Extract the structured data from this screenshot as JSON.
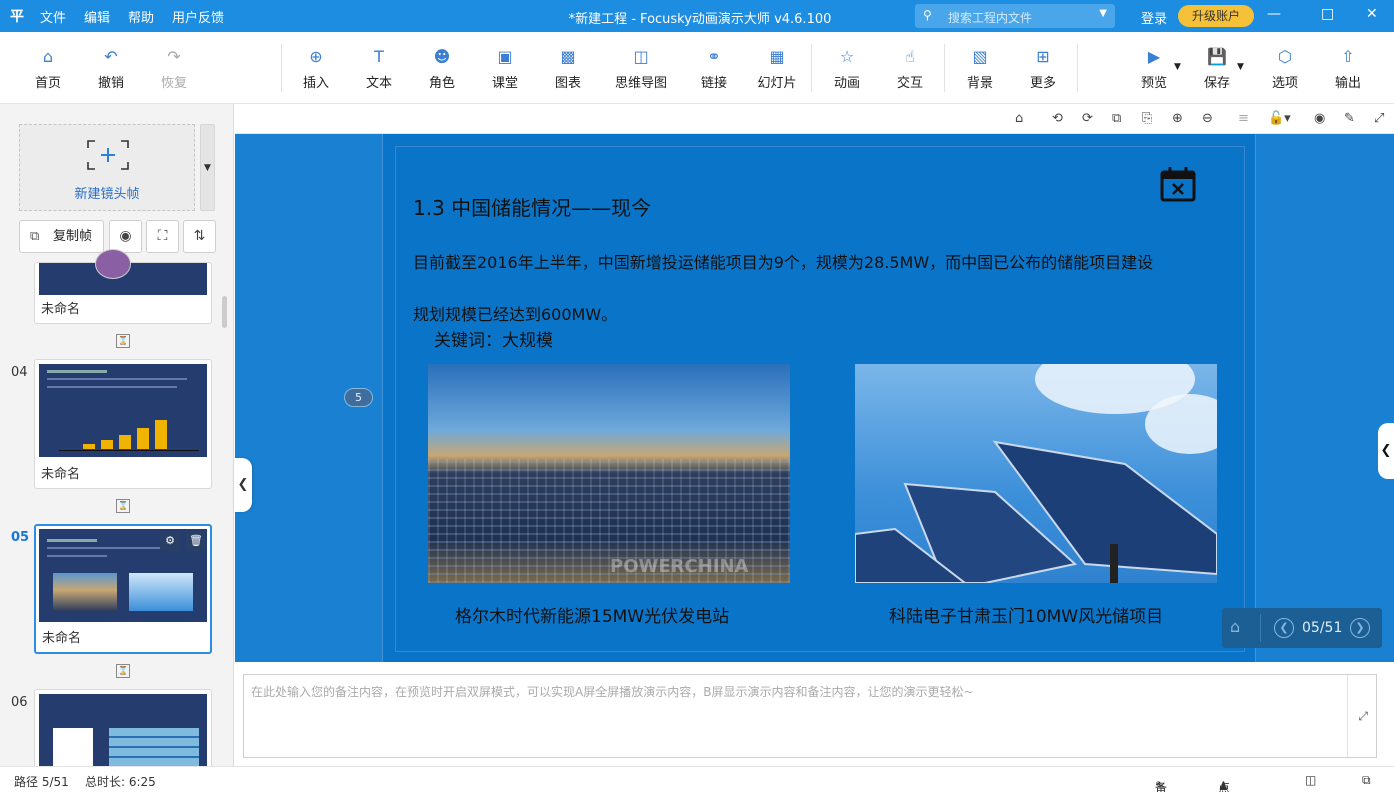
{
  "app": {
    "logo": "平",
    "menu": [
      "文件",
      "编辑",
      "帮助",
      "用户反馈"
    ],
    "title": "*新建工程 - Focusky动画演示大师  v4.6.100",
    "search_placeholder": "搜索工程内文件",
    "login": "登录",
    "upgrade": "升级账户"
  },
  "toolbar": {
    "home": "首页",
    "undo": "撤销",
    "redo": "恢复",
    "insert": "插入",
    "text": "文本",
    "role": "角色",
    "classroom": "课堂",
    "chart": "图表",
    "mindmap": "思维导图",
    "link": "链接",
    "slide": "幻灯片",
    "animation": "动画",
    "interact": "交互",
    "background": "背景",
    "more": "更多",
    "preview": "预览",
    "save": "保存",
    "options": "选项",
    "export": "输出"
  },
  "leftpane": {
    "new_frame": "新建镜头帧",
    "copy_frame": "复制帧",
    "frames": [
      {
        "num": "",
        "name": "未命名"
      },
      {
        "num": "04",
        "name": "未命名"
      },
      {
        "num": "05",
        "name": "未命名"
      },
      {
        "num": "06",
        "name": ""
      }
    ]
  },
  "slide": {
    "title": "1.3 中国储能情况——现今",
    "para1": "目前截至2016年上半年，中国新增投运储能项目为9个，规模为28.5MW，而中国已公布的储能项目建设",
    "para2": "规划规模已经达到600MW。",
    "keyword": "关键词：大规模",
    "photo1_watermark": "POWERCHINA",
    "caption1": "格尔木时代新能源15MW光伏发电站",
    "caption2": "科陆电子甘肃玉门10MW风光储项目",
    "path_badge": "5"
  },
  "nav": {
    "page": "05/51"
  },
  "notes": {
    "placeholder": "在此处输入您的备注内容，在预览时开启双屏模式，可以实现A屏全屏播放演示内容，B屏显示演示内容和备注内容，让您的演示更轻松~"
  },
  "status": {
    "path": "路径 5/51",
    "duration": "总时长: 6:25",
    "notes": "备注",
    "rollcall": "点名"
  }
}
